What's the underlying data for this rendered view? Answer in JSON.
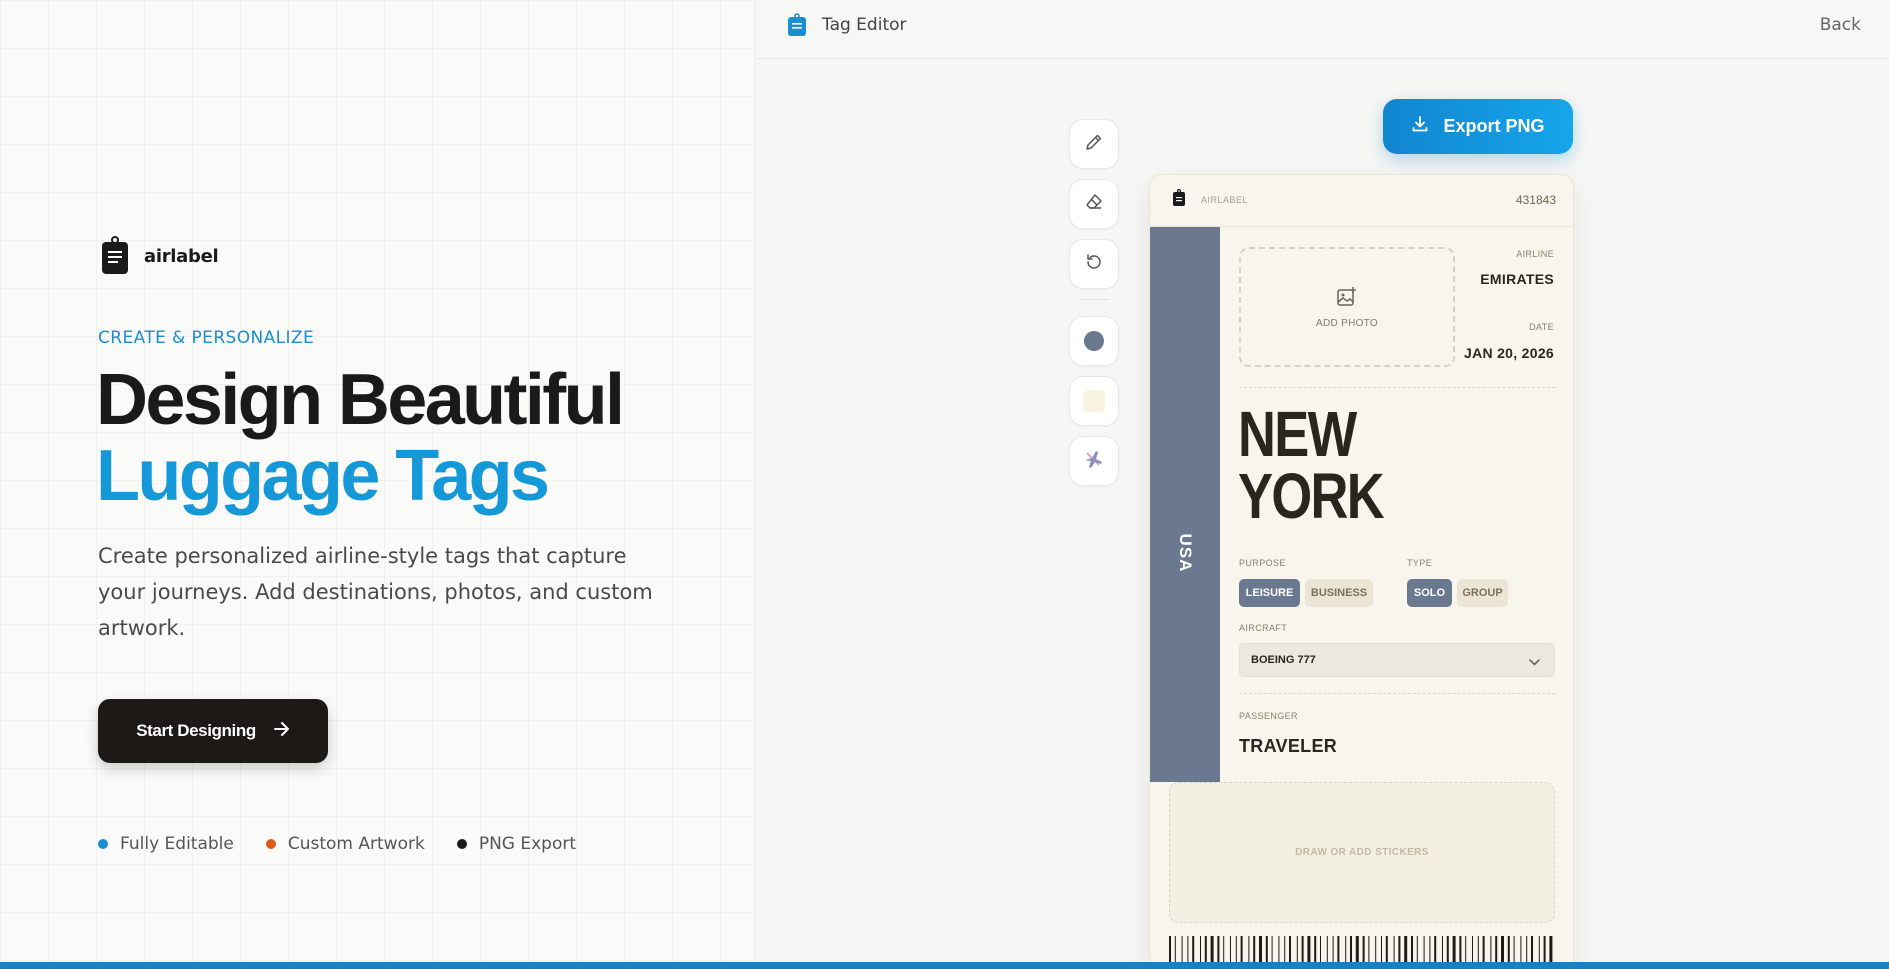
{
  "brand": {
    "name": "airlabel"
  },
  "hero": {
    "eyebrow": "CREATE & PERSONALIZE",
    "headline_line1": "Design Beautiful",
    "headline_line2": "Luggage Tags",
    "lead": "Create personalized airline-style tags that capture your journeys. Add destinations, photos, and custom artwork.",
    "cta_label": "Start Designing"
  },
  "features": [
    {
      "label": "Fully Editable",
      "color": "#1a8fd0"
    },
    {
      "label": "Custom Artwork",
      "color": "#e05a1e"
    },
    {
      "label": "PNG Export",
      "color": "#1c1917"
    }
  ],
  "editor": {
    "title": "Tag Editor",
    "back_label": "Back",
    "export_label": "Export PNG",
    "tools": [
      "pencil-icon",
      "eraser-icon",
      "reset-icon",
      "color-swatch-slate",
      "color-swatch-cream",
      "plane-sticker-icon"
    ],
    "colors": {
      "stripe": "#6a7890",
      "cream": "#f8f5ec",
      "accent": "#1598d8"
    }
  },
  "tag": {
    "brand": "AIRLABEL",
    "code": "431843",
    "country": "USA",
    "add_photo": "ADD PHOTO",
    "airline_label": "AIRLINE",
    "airline": "EMIRATES",
    "date_label": "DATE",
    "date": "JAN 20, 2026",
    "city_line1": "NEW",
    "city_line2": "YORK",
    "purpose_label": "PURPOSE",
    "purpose_options": [
      "LEISURE",
      "BUSINESS"
    ],
    "purpose_selected": "LEISURE",
    "type_label": "TYPE",
    "type_options": [
      "SOLO",
      "GROUP"
    ],
    "type_selected": "SOLO",
    "aircraft_label": "AIRCRAFT",
    "aircraft": "BOEING 777",
    "passenger_label": "PASSENGER",
    "passenger": "TRAVELER",
    "stickers_placeholder": "DRAW OR ADD STICKERS"
  }
}
